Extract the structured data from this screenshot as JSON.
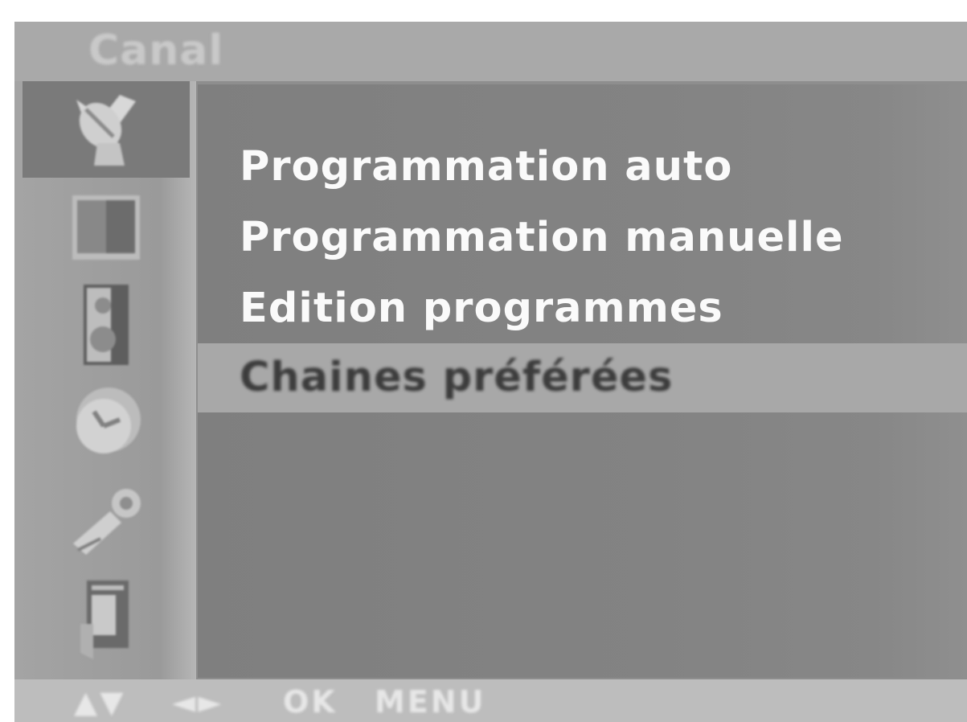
{
  "header": {
    "title": "Canal"
  },
  "sidebar": {
    "items": [
      {
        "icon": "satellite-dish-icon",
        "selected": true
      },
      {
        "icon": "picture-icon",
        "selected": false
      },
      {
        "icon": "speaker-icon",
        "selected": false
      },
      {
        "icon": "clock-icon",
        "selected": false
      },
      {
        "icon": "setup-icon",
        "selected": false
      },
      {
        "icon": "teletext-icon",
        "selected": false
      }
    ]
  },
  "menu": {
    "items": [
      {
        "label": "Programmation auto",
        "highlighted": false
      },
      {
        "label": "Programmation manuelle",
        "highlighted": false
      },
      {
        "label": "Edition programmes",
        "highlighted": false
      },
      {
        "label": "Chaines préférées",
        "highlighted": true
      }
    ]
  },
  "footer": {
    "updown": "▲▼",
    "leftright": "◄►",
    "ok": "OK",
    "menu": "MENU"
  },
  "colors": {
    "title_bar": "#a9a9a9",
    "content_bg": "#838383",
    "highlight": "#a8a8a8",
    "text": "#fafafa"
  }
}
